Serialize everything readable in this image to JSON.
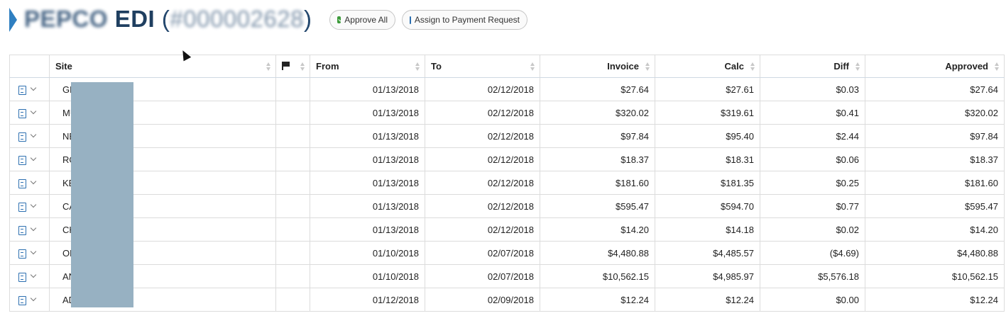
{
  "header": {
    "title": "PEPCO",
    "title_suffix": "EDI",
    "account_id": "#000002628",
    "approve_all_label": "Approve All",
    "assign_label": "Assign to Payment Request"
  },
  "table": {
    "columns": {
      "site": "Site",
      "from": "From",
      "to": "To",
      "invoice": "Invoice",
      "calc": "Calc",
      "diff": "Diff",
      "approved": "Approved"
    },
    "rows": [
      {
        "site": "GR          PRV",
        "from": "01/13/2018",
        "to": "02/12/2018",
        "invoice": "$27.64",
        "calc": "$27.61",
        "diff": "$0.03",
        "approved": "$27.64"
      },
      {
        "site": "MU",
        "from": "01/13/2018",
        "to": "02/12/2018",
        "invoice": "$320.02",
        "calc": "$319.61",
        "diff": "$0.41",
        "approved": "$320.02"
      },
      {
        "site": "NE          PRV",
        "from": "01/13/2018",
        "to": "02/12/2018",
        "invoice": "$97.84",
        "calc": "$95.40",
        "diff": "$2.44",
        "approved": "$97.84"
      },
      {
        "site": "RO",
        "from": "01/13/2018",
        "to": "02/12/2018",
        "invoice": "$18.37",
        "calc": "$18.31",
        "diff": "$0.06",
        "approved": "$18.37"
      },
      {
        "site": "KE          RV",
        "from": "01/13/2018",
        "to": "02/12/2018",
        "invoice": "$181.60",
        "calc": "$181.35",
        "diff": "$0.25",
        "approved": "$181.60"
      },
      {
        "site": "CA",
        "from": "01/13/2018",
        "to": "02/12/2018",
        "invoice": "$595.47",
        "calc": "$594.70",
        "diff": "$0.77",
        "approved": "$595.47"
      },
      {
        "site": "CH          LANE",
        "from": "01/13/2018",
        "to": "02/12/2018",
        "invoice": "$14.20",
        "calc": "$14.18",
        "diff": "$0.02",
        "approved": "$14.20"
      },
      {
        "site": "OL",
        "from": "01/10/2018",
        "to": "02/07/2018",
        "invoice": "$4,480.88",
        "calc": "$4,485.57",
        "diff": "($4.69)",
        "approved": "$4,480.88"
      },
      {
        "site": "AN          D",
        "from": "01/10/2018",
        "to": "02/07/2018",
        "invoice": "$10,562.15",
        "calc": "$4,985.97",
        "diff": "$5,576.18",
        "approved": "$10,562.15"
      },
      {
        "site": "AD",
        "from": "01/12/2018",
        "to": "02/09/2018",
        "invoice": "$12.24",
        "calc": "$12.24",
        "diff": "$0.00",
        "approved": "$12.24"
      }
    ]
  },
  "colors": {
    "accent": "#2f7fc1",
    "title": "#1f3f60",
    "redaction": "#97b1c2",
    "approve_check": "#3c9a3a"
  }
}
